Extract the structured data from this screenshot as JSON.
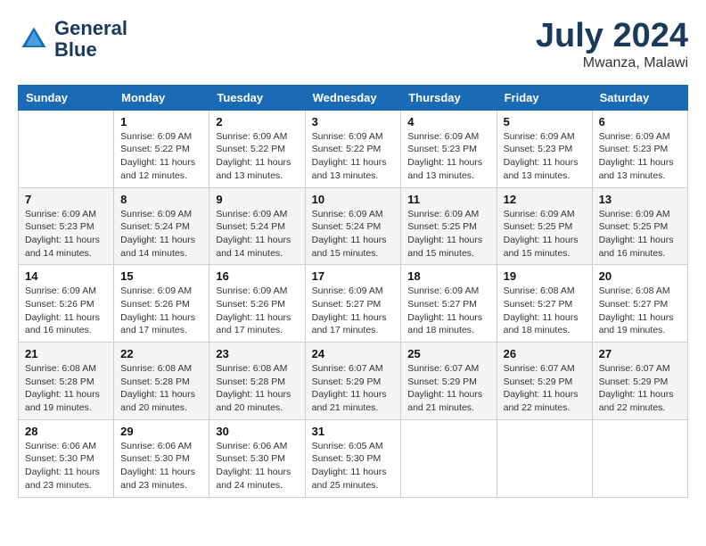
{
  "header": {
    "logo_line1": "General",
    "logo_line2": "Blue",
    "month": "July 2024",
    "location": "Mwanza, Malawi"
  },
  "days_of_week": [
    "Sunday",
    "Monday",
    "Tuesday",
    "Wednesday",
    "Thursday",
    "Friday",
    "Saturday"
  ],
  "weeks": [
    [
      {
        "day": "",
        "sunrise": "",
        "sunset": "",
        "daylight": ""
      },
      {
        "day": "1",
        "sunrise": "Sunrise: 6:09 AM",
        "sunset": "Sunset: 5:22 PM",
        "daylight": "Daylight: 11 hours and 12 minutes."
      },
      {
        "day": "2",
        "sunrise": "Sunrise: 6:09 AM",
        "sunset": "Sunset: 5:22 PM",
        "daylight": "Daylight: 11 hours and 13 minutes."
      },
      {
        "day": "3",
        "sunrise": "Sunrise: 6:09 AM",
        "sunset": "Sunset: 5:22 PM",
        "daylight": "Daylight: 11 hours and 13 minutes."
      },
      {
        "day": "4",
        "sunrise": "Sunrise: 6:09 AM",
        "sunset": "Sunset: 5:23 PM",
        "daylight": "Daylight: 11 hours and 13 minutes."
      },
      {
        "day": "5",
        "sunrise": "Sunrise: 6:09 AM",
        "sunset": "Sunset: 5:23 PM",
        "daylight": "Daylight: 11 hours and 13 minutes."
      },
      {
        "day": "6",
        "sunrise": "Sunrise: 6:09 AM",
        "sunset": "Sunset: 5:23 PM",
        "daylight": "Daylight: 11 hours and 13 minutes."
      }
    ],
    [
      {
        "day": "7",
        "sunrise": "Sunrise: 6:09 AM",
        "sunset": "Sunset: 5:23 PM",
        "daylight": "Daylight: 11 hours and 14 minutes."
      },
      {
        "day": "8",
        "sunrise": "Sunrise: 6:09 AM",
        "sunset": "Sunset: 5:24 PM",
        "daylight": "Daylight: 11 hours and 14 minutes."
      },
      {
        "day": "9",
        "sunrise": "Sunrise: 6:09 AM",
        "sunset": "Sunset: 5:24 PM",
        "daylight": "Daylight: 11 hours and 14 minutes."
      },
      {
        "day": "10",
        "sunrise": "Sunrise: 6:09 AM",
        "sunset": "Sunset: 5:24 PM",
        "daylight": "Daylight: 11 hours and 15 minutes."
      },
      {
        "day": "11",
        "sunrise": "Sunrise: 6:09 AM",
        "sunset": "Sunset: 5:25 PM",
        "daylight": "Daylight: 11 hours and 15 minutes."
      },
      {
        "day": "12",
        "sunrise": "Sunrise: 6:09 AM",
        "sunset": "Sunset: 5:25 PM",
        "daylight": "Daylight: 11 hours and 15 minutes."
      },
      {
        "day": "13",
        "sunrise": "Sunrise: 6:09 AM",
        "sunset": "Sunset: 5:25 PM",
        "daylight": "Daylight: 11 hours and 16 minutes."
      }
    ],
    [
      {
        "day": "14",
        "sunrise": "Sunrise: 6:09 AM",
        "sunset": "Sunset: 5:26 PM",
        "daylight": "Daylight: 11 hours and 16 minutes."
      },
      {
        "day": "15",
        "sunrise": "Sunrise: 6:09 AM",
        "sunset": "Sunset: 5:26 PM",
        "daylight": "Daylight: 11 hours and 17 minutes."
      },
      {
        "day": "16",
        "sunrise": "Sunrise: 6:09 AM",
        "sunset": "Sunset: 5:26 PM",
        "daylight": "Daylight: 11 hours and 17 minutes."
      },
      {
        "day": "17",
        "sunrise": "Sunrise: 6:09 AM",
        "sunset": "Sunset: 5:27 PM",
        "daylight": "Daylight: 11 hours and 17 minutes."
      },
      {
        "day": "18",
        "sunrise": "Sunrise: 6:09 AM",
        "sunset": "Sunset: 5:27 PM",
        "daylight": "Daylight: 11 hours and 18 minutes."
      },
      {
        "day": "19",
        "sunrise": "Sunrise: 6:08 AM",
        "sunset": "Sunset: 5:27 PM",
        "daylight": "Daylight: 11 hours and 18 minutes."
      },
      {
        "day": "20",
        "sunrise": "Sunrise: 6:08 AM",
        "sunset": "Sunset: 5:27 PM",
        "daylight": "Daylight: 11 hours and 19 minutes."
      }
    ],
    [
      {
        "day": "21",
        "sunrise": "Sunrise: 6:08 AM",
        "sunset": "Sunset: 5:28 PM",
        "daylight": "Daylight: 11 hours and 19 minutes."
      },
      {
        "day": "22",
        "sunrise": "Sunrise: 6:08 AM",
        "sunset": "Sunset: 5:28 PM",
        "daylight": "Daylight: 11 hours and 20 minutes."
      },
      {
        "day": "23",
        "sunrise": "Sunrise: 6:08 AM",
        "sunset": "Sunset: 5:28 PM",
        "daylight": "Daylight: 11 hours and 20 minutes."
      },
      {
        "day": "24",
        "sunrise": "Sunrise: 6:07 AM",
        "sunset": "Sunset: 5:29 PM",
        "daylight": "Daylight: 11 hours and 21 minutes."
      },
      {
        "day": "25",
        "sunrise": "Sunrise: 6:07 AM",
        "sunset": "Sunset: 5:29 PM",
        "daylight": "Daylight: 11 hours and 21 minutes."
      },
      {
        "day": "26",
        "sunrise": "Sunrise: 6:07 AM",
        "sunset": "Sunset: 5:29 PM",
        "daylight": "Daylight: 11 hours and 22 minutes."
      },
      {
        "day": "27",
        "sunrise": "Sunrise: 6:07 AM",
        "sunset": "Sunset: 5:29 PM",
        "daylight": "Daylight: 11 hours and 22 minutes."
      }
    ],
    [
      {
        "day": "28",
        "sunrise": "Sunrise: 6:06 AM",
        "sunset": "Sunset: 5:30 PM",
        "daylight": "Daylight: 11 hours and 23 minutes."
      },
      {
        "day": "29",
        "sunrise": "Sunrise: 6:06 AM",
        "sunset": "Sunset: 5:30 PM",
        "daylight": "Daylight: 11 hours and 23 minutes."
      },
      {
        "day": "30",
        "sunrise": "Sunrise: 6:06 AM",
        "sunset": "Sunset: 5:30 PM",
        "daylight": "Daylight: 11 hours and 24 minutes."
      },
      {
        "day": "31",
        "sunrise": "Sunrise: 6:05 AM",
        "sunset": "Sunset: 5:30 PM",
        "daylight": "Daylight: 11 hours and 25 minutes."
      },
      {
        "day": "",
        "sunrise": "",
        "sunset": "",
        "daylight": ""
      },
      {
        "day": "",
        "sunrise": "",
        "sunset": "",
        "daylight": ""
      },
      {
        "day": "",
        "sunrise": "",
        "sunset": "",
        "daylight": ""
      }
    ]
  ]
}
